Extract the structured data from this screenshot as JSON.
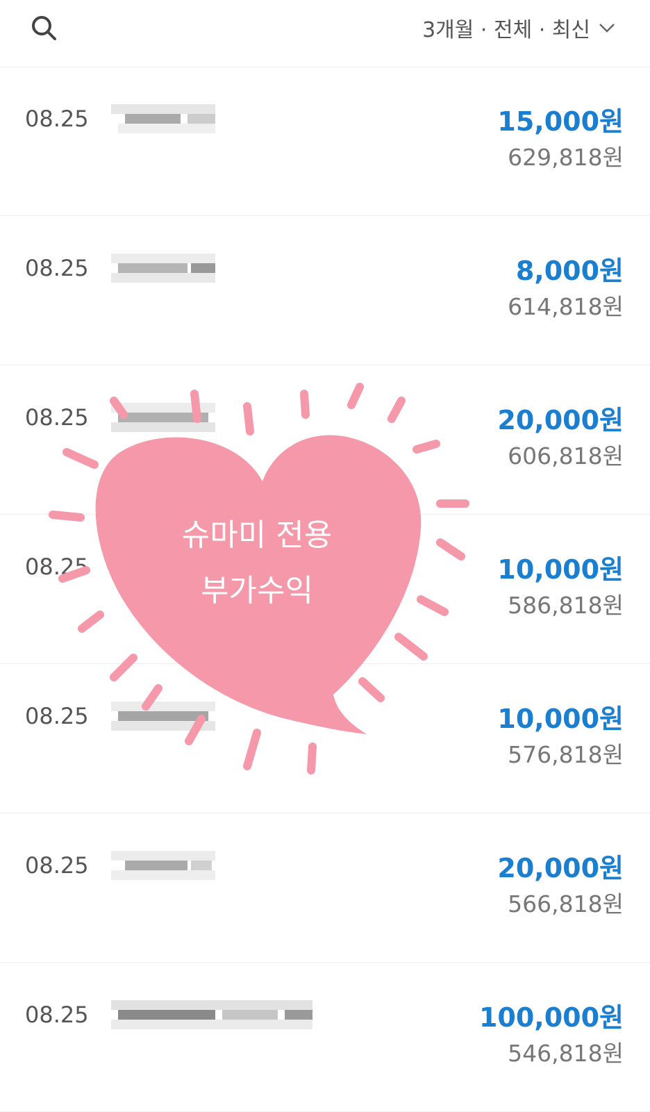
{
  "header": {
    "search_icon": "search-icon",
    "filter_label": "3개월 · 전체 · 최신",
    "filter_icon": "chevron-down-icon"
  },
  "transactions": [
    {
      "date": "08.25",
      "amount": "15,000원",
      "balance": "629,818원"
    },
    {
      "date": "08.25",
      "amount": "8,000원",
      "balance": "614,818원"
    },
    {
      "date": "08.25",
      "amount": "20,000원",
      "balance": "606,818원"
    },
    {
      "date": "08.25",
      "amount": "10,000원",
      "balance": "586,818원"
    },
    {
      "date": "08.25",
      "amount": "10,000원",
      "balance": "576,818원"
    },
    {
      "date": "08.25",
      "amount": "20,000원",
      "balance": "566,818원"
    },
    {
      "date": "08.25",
      "amount": "100,000원",
      "balance": "546,818원"
    }
  ],
  "overlay": {
    "line1": "슈마미 전용",
    "line2": "부가수익",
    "color": "#f598a9"
  },
  "colors": {
    "amount": "#1a7fd0",
    "balance": "#777777",
    "date": "#555555"
  }
}
